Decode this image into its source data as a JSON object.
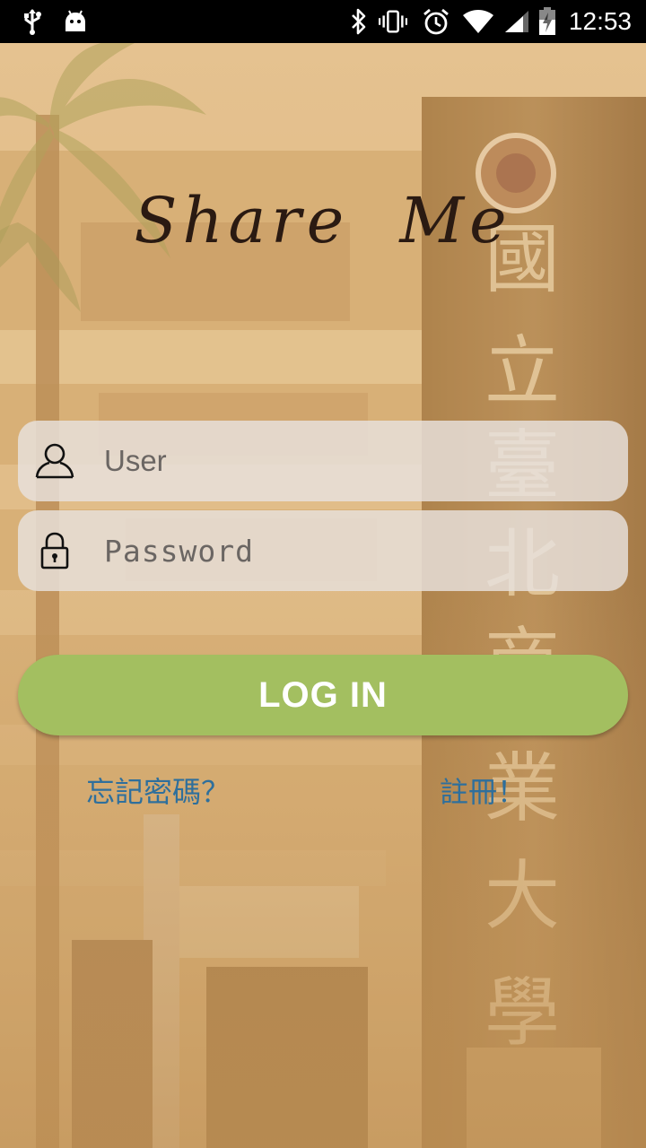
{
  "status_bar": {
    "time": "12:53",
    "left_icons": [
      "usb-icon",
      "android-debug-icon"
    ],
    "right_icons": [
      "bluetooth-icon",
      "vibrate-icon",
      "alarm-icon",
      "wifi-icon",
      "signal-icon",
      "battery-charging-icon"
    ]
  },
  "app": {
    "logo_text": "Share Me"
  },
  "login_form": {
    "user_placeholder": "User",
    "user_value": "",
    "password_placeholder": "Password",
    "password_value": "",
    "login_label": "LOG IN",
    "forgot_password_label": "忘記密碼？",
    "register_label": "註冊！"
  },
  "theme": {
    "login_button_color": "#a3bf60",
    "link_color": "#2e6f9c",
    "background_tint": "#c9a06a"
  }
}
